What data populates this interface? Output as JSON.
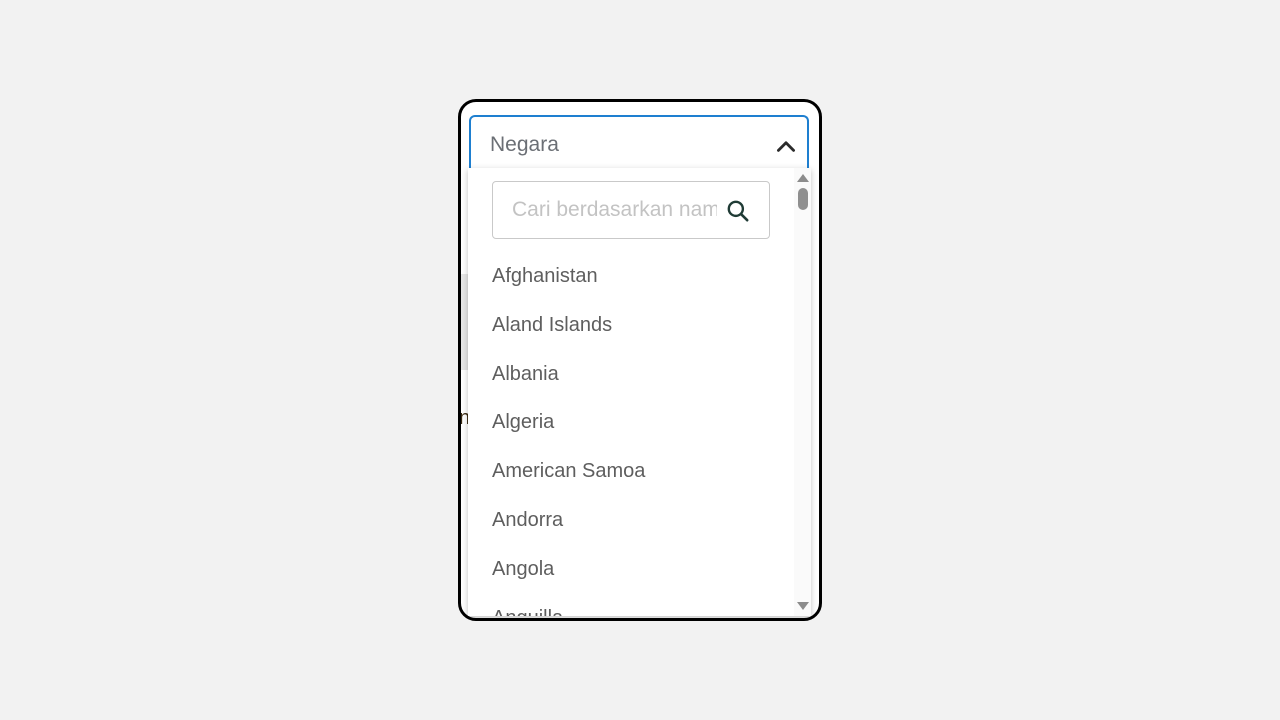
{
  "select": {
    "label": "Negara",
    "icon": "chevron-up-icon",
    "accent_color": "#1e7fd0"
  },
  "search": {
    "placeholder": "Cari berdasarkan nama",
    "value": "",
    "icon": "search-icon"
  },
  "options": [
    "Afghanistan",
    "Aland Islands",
    "Albania",
    "Algeria",
    "American Samoa",
    "Andorra",
    "Angola",
    "Anguilla"
  ]
}
